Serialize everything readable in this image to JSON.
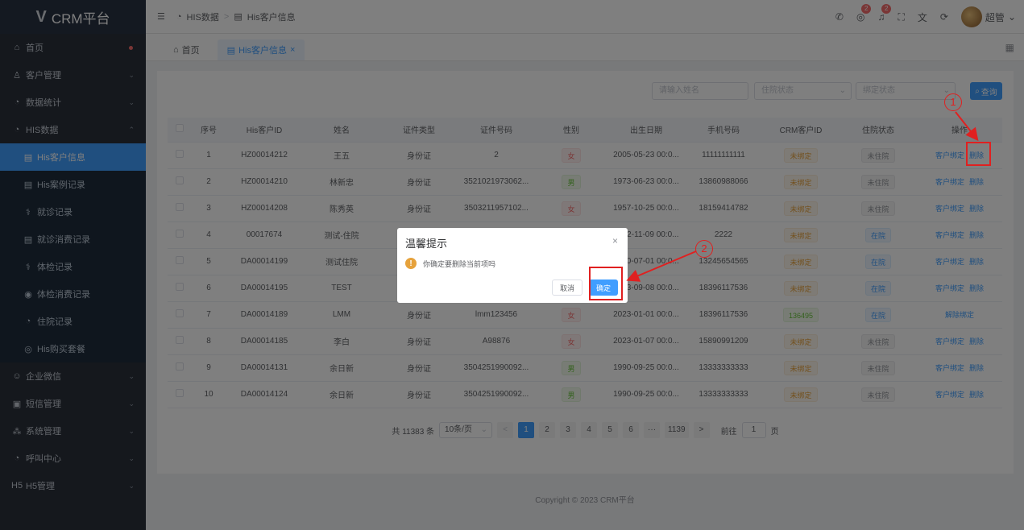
{
  "app": {
    "logo": "CRM平台"
  },
  "sidebar": {
    "items": [
      {
        "icon": "⌂",
        "label": "首页",
        "dot": true
      },
      {
        "icon": "♙",
        "label": "客户管理",
        "arrow": "⌄"
      },
      {
        "icon": "◔",
        "label": "数据统计",
        "arrow": "⌄"
      },
      {
        "icon": "◔",
        "label": "HIS数据",
        "arrow": "⌃"
      }
    ],
    "sub_items": [
      {
        "icon": "▤",
        "label": "His客户信息",
        "active": true
      },
      {
        "icon": "▤",
        "label": "His案例记录"
      },
      {
        "icon": "⚕",
        "label": "就诊记录"
      },
      {
        "icon": "▤",
        "label": "就诊消费记录"
      },
      {
        "icon": "⚕",
        "label": "体检记录"
      },
      {
        "icon": "◉",
        "label": "体检消费记录"
      },
      {
        "icon": "◔",
        "label": "住院记录"
      },
      {
        "icon": "◎",
        "label": "His购买套餐"
      }
    ],
    "items_after": [
      {
        "icon": "☺",
        "label": "企业微信",
        "arrow": "⌄"
      },
      {
        "icon": "▣",
        "label": "短信管理",
        "arrow": "⌄"
      },
      {
        "icon": "⁂",
        "label": "系统管理",
        "arrow": "⌄"
      },
      {
        "icon": "◔",
        "label": "呼叫中心",
        "arrow": "⌄"
      },
      {
        "icon": "H5",
        "label": "H5管理",
        "arrow": "⌄"
      }
    ]
  },
  "header": {
    "breadcrumb": [
      "HIS数据",
      "His客户信息"
    ],
    "badge1": "2",
    "badge2": "2",
    "user": "超管"
  },
  "tabs": [
    {
      "label": "首页",
      "active": false
    },
    {
      "label": "His客户信息",
      "active": true,
      "close": "×"
    }
  ],
  "search": {
    "name_placeholder": "请输入姓名",
    "status_placeholder": "住院状态",
    "bind_placeholder": "绑定状态",
    "query_label": "查询"
  },
  "table": {
    "columns": [
      "序号",
      "His客户ID",
      "姓名",
      "证件类型",
      "证件号码",
      "性别",
      "出生日期",
      "手机号码",
      "CRM客户ID",
      "住院状态",
      "操作"
    ],
    "rows": [
      {
        "no": "1",
        "his_id": "HZ00014212",
        "name": "王五",
        "id_type": "身份证",
        "id_no": "2",
        "gender": "女",
        "birth": "2005-05-23 00:0...",
        "phone": "11111111111",
        "crm_id": "未绑定",
        "status": "未住院",
        "ops": [
          "客户绑定",
          "删除"
        ]
      },
      {
        "no": "2",
        "his_id": "HZ00014210",
        "name": "林新忠",
        "id_type": "身份证",
        "id_no": "3521021973062...",
        "gender": "男",
        "birth": "1973-06-23 00:0...",
        "phone": "13860988066",
        "crm_id": "未绑定",
        "status": "未住院",
        "ops": [
          "客户绑定",
          "删除"
        ]
      },
      {
        "no": "3",
        "his_id": "HZ00014208",
        "name": "陈秀英",
        "id_type": "身份证",
        "id_no": "3503211957102...",
        "gender": "女",
        "birth": "1957-10-25 00:0...",
        "phone": "18159414782",
        "crm_id": "未绑定",
        "status": "未住院",
        "ops": [
          "客户绑定",
          "删除"
        ]
      },
      {
        "no": "4",
        "his_id": "00017674",
        "name": "测试-住院",
        "id_type": "",
        "id_no": "",
        "gender": "",
        "birth": "2022-11-09 00:0...",
        "phone": "2222",
        "crm_id": "未绑定",
        "status": "在院",
        "ops": [
          "客户绑定",
          "删除"
        ]
      },
      {
        "no": "5",
        "his_id": "DA00014199",
        "name": "测试住院",
        "id_type": "",
        "id_no": "",
        "gender": "",
        "birth": "1990-07-01 00:0...",
        "phone": "13245654565",
        "crm_id": "未绑定",
        "status": "在院",
        "ops": [
          "客户绑定",
          "删除"
        ]
      },
      {
        "no": "6",
        "his_id": "DA00014195",
        "name": "TEST",
        "id_type": "",
        "id_no": "",
        "gender": "",
        "birth": "2023-09-08 00:0...",
        "phone": "18396117536",
        "crm_id": "未绑定",
        "status": "在院",
        "ops": [
          "客户绑定",
          "删除"
        ]
      },
      {
        "no": "7",
        "his_id": "DA00014189",
        "name": "LMM",
        "id_type": "身份证",
        "id_no": "lmm123456",
        "gender": "女",
        "birth": "2023-01-01 00:0...",
        "phone": "18396117536",
        "crm_id": "136495",
        "status": "在院",
        "ops": [
          "解除绑定"
        ]
      },
      {
        "no": "8",
        "his_id": "DA00014185",
        "name": "李白",
        "id_type": "身份证",
        "id_no": "A98876",
        "gender": "女",
        "birth": "2023-01-07 00:0...",
        "phone": "15890991209",
        "crm_id": "未绑定",
        "status": "未住院",
        "ops": [
          "客户绑定",
          "删除"
        ]
      },
      {
        "no": "9",
        "his_id": "DA00014131",
        "name": "余日新",
        "id_type": "身份证",
        "id_no": "3504251990092...",
        "gender": "男",
        "birth": "1990-09-25 00:0...",
        "phone": "13333333333",
        "crm_id": "未绑定",
        "status": "未住院",
        "ops": [
          "客户绑定",
          "删除"
        ]
      },
      {
        "no": "10",
        "his_id": "DA00014124",
        "name": "余日新",
        "id_type": "身份证",
        "id_no": "3504251990092...",
        "gender": "男",
        "birth": "1990-09-25 00:0...",
        "phone": "13333333333",
        "crm_id": "未绑定",
        "status": "未住院",
        "ops": [
          "客户绑定",
          "删除"
        ]
      }
    ]
  },
  "pagination": {
    "total": "共 11383 条",
    "page_size": "10条/页",
    "pages": [
      "1",
      "2",
      "3",
      "4",
      "5",
      "6",
      "···",
      "1139"
    ],
    "prev": "<",
    "next": ">",
    "goto_label": "前往",
    "goto_value": "1",
    "page_suffix": "页"
  },
  "footer": {
    "copyright": "Copyright © 2023 CRM平台"
  },
  "dialog": {
    "title": "温馨提示",
    "close": "×",
    "message": "你确定要删除当前项吗",
    "cancel": "取消",
    "confirm": "确定"
  },
  "annotations": [
    "1",
    "2"
  ]
}
